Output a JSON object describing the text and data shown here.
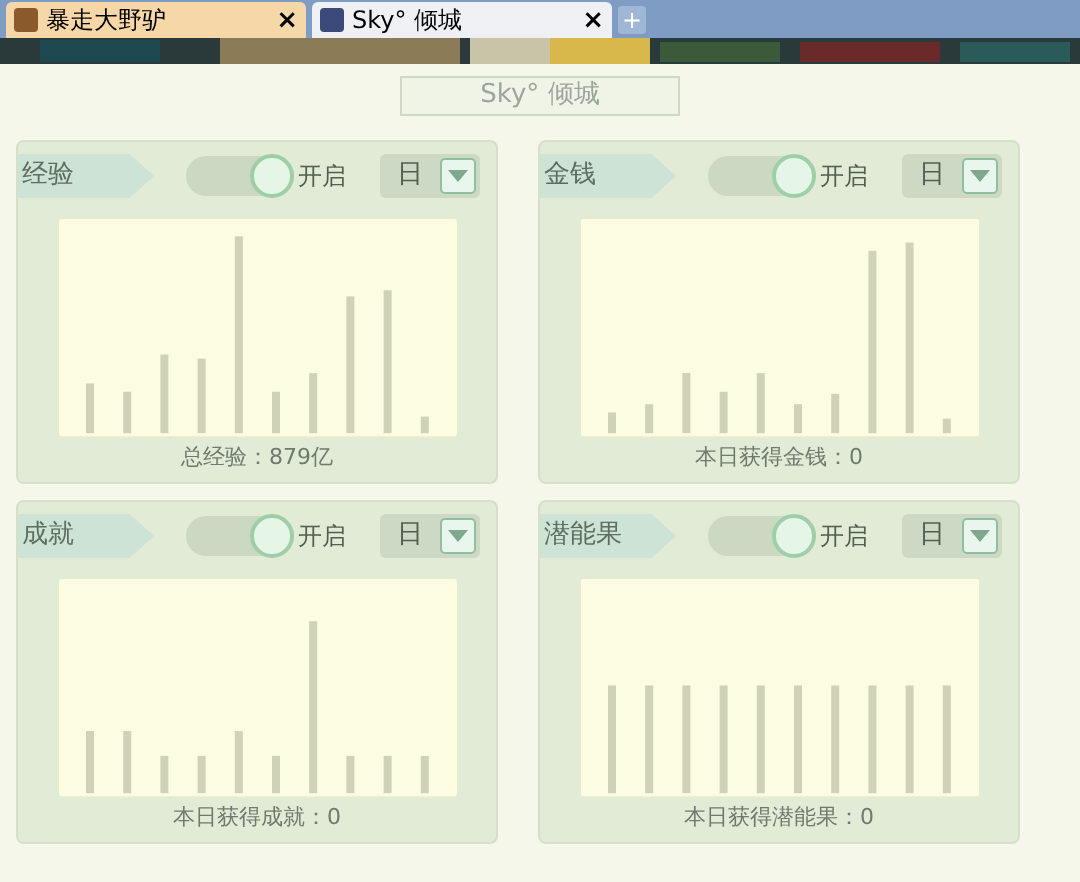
{
  "tabs": [
    {
      "label": "暴走大野驴",
      "close": "×",
      "selected": false
    },
    {
      "label": "Sky° 倾城",
      "close": "×",
      "selected": true
    }
  ],
  "new_tab": "+",
  "title": "Sky° 倾城",
  "panels": [
    {
      "label": "经验",
      "toggle_label": "开启",
      "on": true,
      "period": "日",
      "footer": "总经验：879亿"
    },
    {
      "label": "金钱",
      "toggle_label": "开启",
      "on": true,
      "period": "日",
      "footer": "本日获得金钱：0"
    },
    {
      "label": "成就",
      "toggle_label": "开启",
      "on": true,
      "period": "日",
      "footer": "本日获得成就：0"
    },
    {
      "label": "潜能果",
      "toggle_label": "开启",
      "on": true,
      "period": "日",
      "footer": "本日获得潜能果：0"
    }
  ]
}
